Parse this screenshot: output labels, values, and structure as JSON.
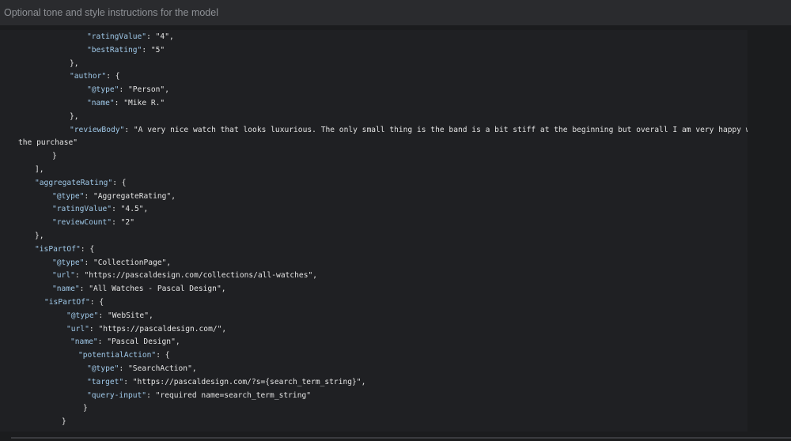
{
  "instructions": {
    "placeholder": "Optional tone and style instructions for the model"
  },
  "code": {
    "lines": [
      {
        "indent": 110,
        "parts": [
          [
            "key",
            "\"ratingValue\""
          ],
          [
            "punc",
            ": "
          ],
          [
            "str",
            "\"4\""
          ],
          [
            "punc",
            ","
          ]
        ]
      },
      {
        "indent": 110,
        "parts": [
          [
            "key",
            "\"bestRating\""
          ],
          [
            "punc",
            ": "
          ],
          [
            "str",
            "\"5\""
          ]
        ]
      },
      {
        "indent": 88,
        "parts": [
          [
            "punc",
            "},"
          ]
        ]
      },
      {
        "indent": 88,
        "parts": [
          [
            "key",
            "\"author\""
          ],
          [
            "punc",
            ": {"
          ]
        ]
      },
      {
        "indent": 110,
        "parts": [
          [
            "key",
            "\"@type\""
          ],
          [
            "punc",
            ": "
          ],
          [
            "str",
            "\"Person\""
          ],
          [
            "punc",
            ","
          ]
        ]
      },
      {
        "indent": 110,
        "parts": [
          [
            "key",
            "\"name\""
          ],
          [
            "punc",
            ": "
          ],
          [
            "str",
            "\"Mike R.\""
          ]
        ]
      },
      {
        "indent": 88,
        "parts": [
          [
            "punc",
            "},"
          ]
        ]
      },
      {
        "indent": 88,
        "parts": [
          [
            "key",
            "\"reviewBody\""
          ],
          [
            "punc",
            ": "
          ],
          [
            "str",
            "\"A very nice watch that looks luxurious. The only small thing is the band is a bit stiff at the beginning but overall I am very happy with"
          ]
        ]
      },
      {
        "indent": 23,
        "parts": [
          [
            "str",
            "the purchase\""
          ]
        ]
      },
      {
        "indent": 66,
        "parts": [
          [
            "punc",
            "}"
          ]
        ]
      },
      {
        "indent": 44,
        "parts": [
          [
            "punc",
            "],"
          ]
        ]
      },
      {
        "indent": 44,
        "parts": [
          [
            "key",
            "\"aggregateRating\""
          ],
          [
            "punc",
            ": {"
          ]
        ]
      },
      {
        "indent": 66,
        "parts": [
          [
            "key",
            "\"@type\""
          ],
          [
            "punc",
            ": "
          ],
          [
            "str",
            "\"AggregateRating\""
          ],
          [
            "punc",
            ","
          ]
        ]
      },
      {
        "indent": 66,
        "parts": [
          [
            "key",
            "\"ratingValue\""
          ],
          [
            "punc",
            ": "
          ],
          [
            "str",
            "\"4.5\""
          ],
          [
            "punc",
            ","
          ]
        ]
      },
      {
        "indent": 66,
        "parts": [
          [
            "key",
            "\"reviewCount\""
          ],
          [
            "punc",
            ": "
          ],
          [
            "str",
            "\"2\""
          ]
        ]
      },
      {
        "indent": 44,
        "parts": [
          [
            "punc",
            "},"
          ]
        ]
      },
      {
        "indent": 44,
        "parts": [
          [
            "key",
            "\"isPartOf\""
          ],
          [
            "punc",
            ": {"
          ]
        ]
      },
      {
        "indent": 66,
        "parts": [
          [
            "key",
            "\"@type\""
          ],
          [
            "punc",
            ": "
          ],
          [
            "str",
            "\"CollectionPage\""
          ],
          [
            "punc",
            ","
          ]
        ]
      },
      {
        "indent": 66,
        "parts": [
          [
            "key",
            "\"url\""
          ],
          [
            "punc",
            ": "
          ],
          [
            "str",
            "\"https://pascaldesign.com/collections/all-watches\""
          ],
          [
            "punc",
            ","
          ]
        ]
      },
      {
        "indent": 66,
        "parts": [
          [
            "key",
            "\"name\""
          ],
          [
            "punc",
            ": "
          ],
          [
            "str",
            "\"All Watches - Pascal Design\""
          ],
          [
            "punc",
            ","
          ]
        ]
      },
      {
        "indent": 56,
        "parts": [
          [
            "key",
            "\"isPartOf\""
          ],
          [
            "punc",
            ": {"
          ]
        ]
      },
      {
        "indent": 84,
        "parts": [
          [
            "key",
            "\"@type\""
          ],
          [
            "punc",
            ": "
          ],
          [
            "str",
            "\"WebSite\""
          ],
          [
            "punc",
            ","
          ]
        ]
      },
      {
        "indent": 84,
        "parts": [
          [
            "key",
            "\"url\""
          ],
          [
            "punc",
            ": "
          ],
          [
            "str",
            "\"https://pascaldesign.com/\""
          ],
          [
            "punc",
            ","
          ]
        ]
      },
      {
        "indent": 89,
        "parts": [
          [
            "key",
            "\"name\""
          ],
          [
            "punc",
            ": "
          ],
          [
            "str",
            "\"Pascal Design\""
          ],
          [
            "punc",
            ","
          ]
        ]
      },
      {
        "indent": 99,
        "parts": [
          [
            "key",
            "\"potentialAction\""
          ],
          [
            "punc",
            ": {"
          ]
        ]
      },
      {
        "indent": 110,
        "parts": [
          [
            "key",
            "\"@type\""
          ],
          [
            "punc",
            ": "
          ],
          [
            "str",
            "\"SearchAction\""
          ],
          [
            "punc",
            ","
          ]
        ]
      },
      {
        "indent": 110,
        "parts": [
          [
            "key",
            "\"target\""
          ],
          [
            "punc",
            ": "
          ],
          [
            "str",
            "\"https://pascaldesign.com/?s={search_term_string}\""
          ],
          [
            "punc",
            ","
          ]
        ]
      },
      {
        "indent": 110,
        "parts": [
          [
            "key",
            "\"query-input\""
          ],
          [
            "punc",
            ": "
          ],
          [
            "str",
            "\"required name=search_term_string\""
          ]
        ]
      },
      {
        "indent": 105,
        "parts": [
          [
            "punc",
            "}"
          ]
        ]
      },
      {
        "indent": 78,
        "parts": [
          [
            "punc",
            "}"
          ]
        ]
      }
    ]
  },
  "colors": {
    "key": "#9fc8e8",
    "text": "#e3e3e3",
    "panel": "#1f2023",
    "background": "#1b1c1e"
  }
}
